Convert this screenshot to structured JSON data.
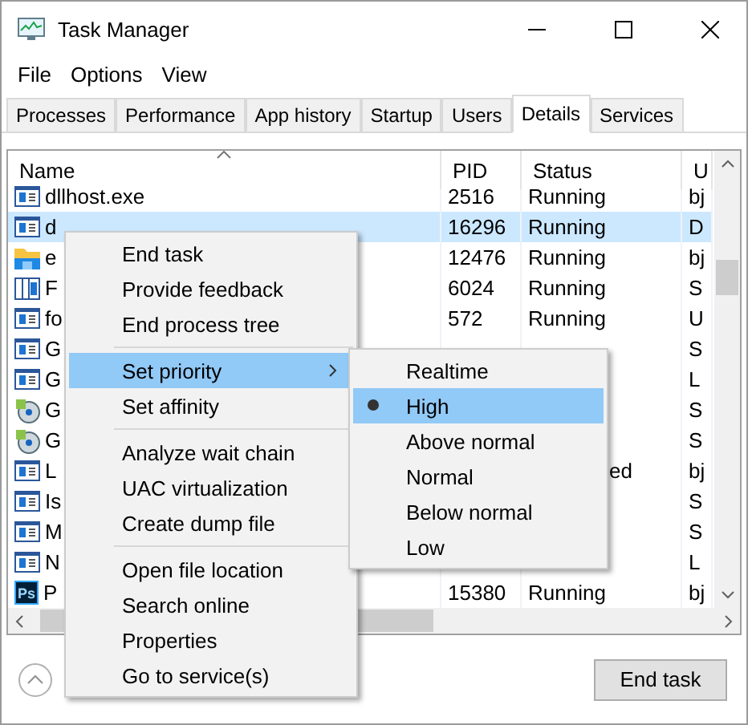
{
  "window": {
    "title": "Task Manager"
  },
  "menu_bar": [
    "File",
    "Options",
    "View"
  ],
  "tabs": [
    {
      "label": "Processes",
      "selected": false
    },
    {
      "label": "Performance",
      "selected": false
    },
    {
      "label": "App history",
      "selected": false
    },
    {
      "label": "Startup",
      "selected": false
    },
    {
      "label": "Users",
      "selected": false
    },
    {
      "label": "Details",
      "selected": true
    },
    {
      "label": "Services",
      "selected": false
    }
  ],
  "table": {
    "columns": [
      "Name",
      "PID",
      "Status",
      "U"
    ],
    "rows": [
      {
        "kind": "window",
        "name": "dllhost.exe",
        "pid": "2516",
        "status": "Running",
        "user": "bj",
        "selected": false
      },
      {
        "kind": "window",
        "name": "d",
        "pid": "16296",
        "status": "Running",
        "user": "D",
        "selected": true
      },
      {
        "kind": "folder",
        "name": "e",
        "pid": "12476",
        "status": "Running",
        "user": "bj",
        "selected": false
      },
      {
        "kind": "panel",
        "name": "F",
        "pid": "6024",
        "status": "Running",
        "user": "S",
        "selected": false
      },
      {
        "kind": "window",
        "name": "fo",
        "pid": "572",
        "status": "Running",
        "user": "U",
        "selected": false
      },
      {
        "kind": "window",
        "name": "G",
        "user": "S",
        "selected": false
      },
      {
        "kind": "window",
        "name": "G",
        "user": "L",
        "selected": false
      },
      {
        "kind": "disc",
        "name": "G",
        "user": "S",
        "selected": false
      },
      {
        "kind": "disc",
        "name": "G",
        "user": "S",
        "selected": false
      },
      {
        "kind": "window",
        "name": "L",
        "status": "ed",
        "status_clipped": true,
        "user": "bj",
        "selected": false
      },
      {
        "kind": "window",
        "name": "Is",
        "user": "S",
        "selected": false
      },
      {
        "kind": "window",
        "name": "M",
        "user": "S",
        "selected": false
      },
      {
        "kind": "window",
        "name": "N",
        "user": "L",
        "selected": false
      },
      {
        "kind": "ps",
        "icon_text": "Ps",
        "name": "P",
        "pid": "15380",
        "status": "Running",
        "user": "bj",
        "selected": false
      }
    ]
  },
  "context_menu": {
    "groups": [
      [
        {
          "label": "End task",
          "selected": false
        },
        {
          "label": "Provide feedback",
          "selected": false
        },
        {
          "label": "End process tree",
          "selected": false
        }
      ],
      [
        {
          "label": "Set priority",
          "selected": true,
          "submenu": true
        },
        {
          "label": "Set affinity",
          "selected": false
        }
      ],
      [
        {
          "label": "Analyze wait chain",
          "selected": false
        },
        {
          "label": "UAC virtualization",
          "selected": false
        },
        {
          "label": "Create dump file",
          "selected": false
        }
      ],
      [
        {
          "label": "Open file location",
          "selected": false
        },
        {
          "label": "Search online",
          "selected": false
        },
        {
          "label": "Properties",
          "selected": false
        },
        {
          "label": "Go to service(s)",
          "selected": false
        }
      ]
    ]
  },
  "priority_menu": [
    {
      "label": "Realtime",
      "selected": false
    },
    {
      "label": "High",
      "selected": true
    },
    {
      "label": "Above normal",
      "selected": false
    },
    {
      "label": "Normal",
      "selected": false
    },
    {
      "label": "Below normal",
      "selected": false
    },
    {
      "label": "Low",
      "selected": false
    }
  ],
  "end_task_button": "End task"
}
